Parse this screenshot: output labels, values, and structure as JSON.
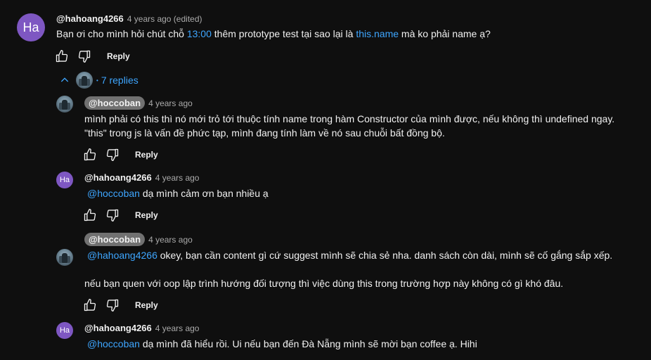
{
  "main_comment": {
    "avatar_initials": "Ha",
    "author": "@hahoang4266",
    "meta": "4 years ago (edited)",
    "text_part1": "Bạn ơi cho mình hỏi chút chỗ ",
    "timestamp_link": "13:00",
    "text_part2": " thêm prototype test tại sao lại là ",
    "code_link": "this.name",
    "text_part3": " mà ko phải name ạ?",
    "reply_label": "Reply"
  },
  "replies_toggle": {
    "label": "7 replies"
  },
  "replies": [
    {
      "author": "@hoccoban",
      "meta": "4 years ago",
      "line1": "mình phải có this thì nó mới trỏ tới thuộc tính name trong hàm Constructor của mình được, nếu không thì undefined ngay.",
      "line2": "\"this\" trong js là vấn đề phức tạp, mình đang tính làm về nó sau chuỗi bất đồng bộ.",
      "reply_label": "Reply"
    },
    {
      "avatar_initials": "Ha",
      "author": "@hahoang4266",
      "meta": "4 years ago",
      "mention": "@hoccoban",
      "text": " dạ mình cảm ơn bạn nhiều ạ",
      "reply_label": "Reply"
    },
    {
      "author": "@hoccoban",
      "meta": "4 years ago",
      "mention": "@hahoang4266",
      "line1": " okey, bạn cần content gì cứ suggest mình sẽ chia sẻ nha. danh sách còn dài, mình sẽ cố gắng sắp xếp.",
      "line2": "nếu bạn quen với oop lập trình hướng đối tượng thì việc dùng this trong trường hợp này không có gì khó đâu.",
      "reply_label": "Reply"
    },
    {
      "avatar_initials": "Ha",
      "author": "@hahoang4266",
      "meta": "4 years ago",
      "mention": "@hoccoban",
      "text": " dạ mình đã hiểu rồi. Ui nếu bạn đến Đà Nẵng mình sẽ mời bạn coffee ạ. Hihi"
    }
  ],
  "colors": {
    "background": "#0f0f0f",
    "link": "#3ea6ff",
    "avatar": "#7e57c2",
    "badge": "#717171"
  }
}
